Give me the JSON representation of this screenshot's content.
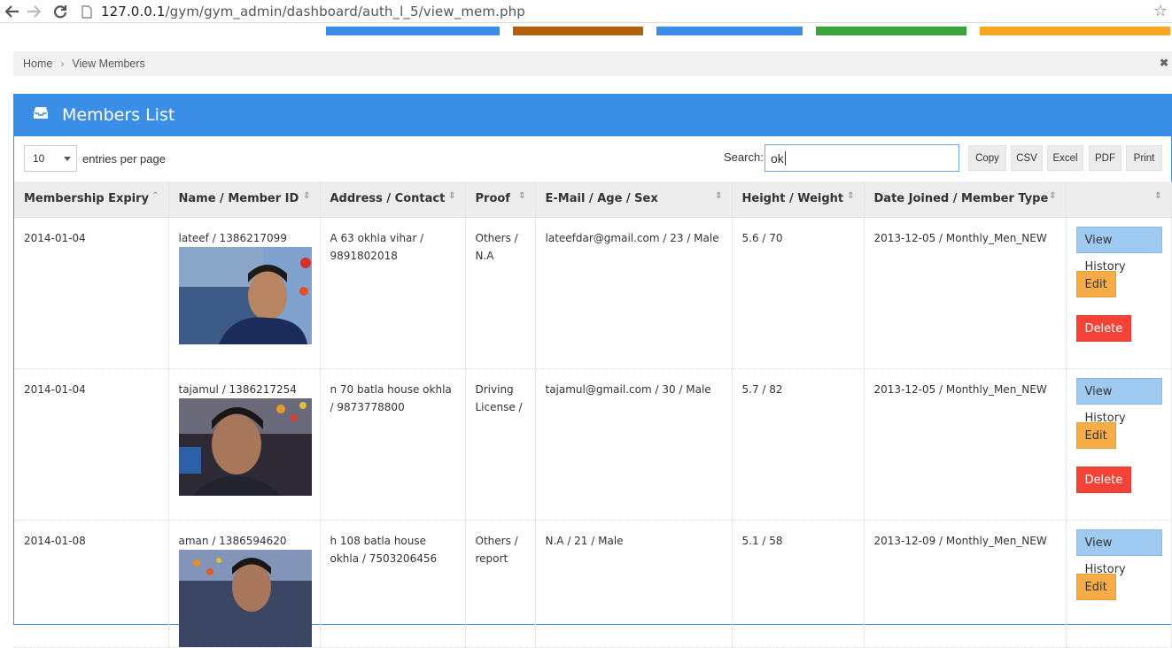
{
  "browser": {
    "url_host": "127.0.0.1",
    "url_path": "/gym/gym_admin/dashboard/auth_l_5/view_mem.php"
  },
  "stripes": [
    {
      "color": "#3a8ee6"
    },
    {
      "color": "#b25f0f"
    },
    {
      "color": "#3a8ee6"
    },
    {
      "color": "#3aa43a"
    },
    {
      "color": "#f5a623"
    }
  ],
  "breadcrumb": {
    "home": "Home",
    "separator": "›",
    "current": "View Members",
    "close": "✖"
  },
  "panel": {
    "title": "Members List",
    "icon": "inbox-icon"
  },
  "controls": {
    "entries_value": "10",
    "entries_label": "entries per page",
    "search_label": "Search:",
    "search_value": "ok",
    "buttons": [
      "Copy",
      "CSV",
      "Excel",
      "PDF",
      "Print"
    ]
  },
  "table": {
    "columns": [
      "Membership Expiry",
      "Name / Member ID",
      "Address / Contact",
      "Proof",
      "E-Mail / Age / Sex",
      "Height / Weight",
      "Date Joined / Member Type",
      ""
    ],
    "rows": [
      {
        "expiry": "2014-01-04",
        "name": "lateef / 1386217099",
        "address": "A 63 okhla vihar / 9891802018",
        "proof": "Others / N.A",
        "email": "lateefdar@gmail.com / 23 / Male",
        "hw": "5.6 / 70",
        "joined": "2013-12-05 / Monthly_Men_NEW"
      },
      {
        "expiry": "2014-01-04",
        "name": "tajamul / 1386217254",
        "address": "n 70 batla house okhla / 9873778800",
        "proof": "Driving License /",
        "email": "tajamul@gmail.com / 30 / Male",
        "hw": "5.7 / 82",
        "joined": "2013-12-05 / Monthly_Men_NEW"
      },
      {
        "expiry": "2014-01-08",
        "name": "aman / 1386594620",
        "address": "h 108 batla house okhla / 7503206456",
        "proof": "Others / report",
        "email": "N.A / 21 / Male",
        "hw": "5.1 / 58",
        "joined": "2013-12-09 / Monthly_Men_NEW"
      }
    ],
    "actions": {
      "history": "View History",
      "edit": "Edit",
      "delete": "Delete"
    }
  }
}
